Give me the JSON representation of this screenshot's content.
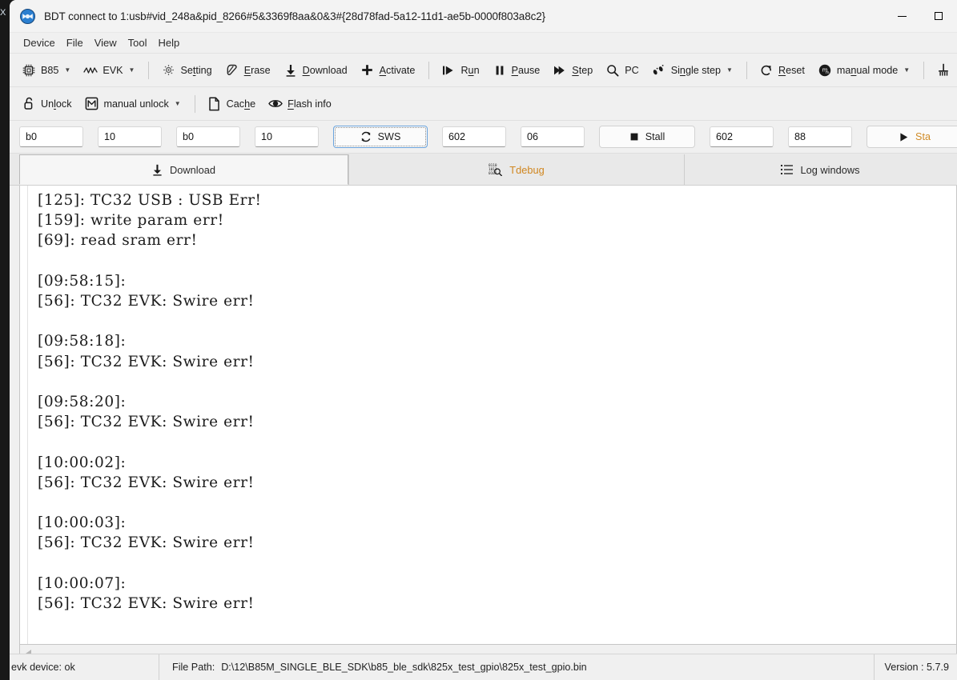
{
  "desktop": {
    "corner_glyph": "X"
  },
  "window": {
    "title": "BDT connect to 1:usb#vid_248a&pid_8266#5&3369f8aa&0&3#{28d78fad-5a12-11d1-ae5b-0000f803a8c2}",
    "app_icon": "bdt-app-icon",
    "controls": {
      "minimize": "minimize",
      "maximize": "maximize"
    }
  },
  "menubar": {
    "items": [
      {
        "label": "Device"
      },
      {
        "label": "File"
      },
      {
        "label": "View"
      },
      {
        "label": "Tool"
      },
      {
        "label": "Help"
      }
    ]
  },
  "toolbar_main": {
    "items": [
      {
        "label": "B85",
        "icon": "chip-icon",
        "caret": true
      },
      {
        "label": "EVK",
        "icon": "waveform-icon",
        "caret": true
      },
      {
        "sep": true
      },
      {
        "label": "Setting",
        "icon": "gear-icon",
        "accel": "t"
      },
      {
        "label": "Erase",
        "icon": "eraser-icon",
        "accel": "E"
      },
      {
        "label": "Download",
        "icon": "download-arrow-icon",
        "accel": "D"
      },
      {
        "label": "Activate",
        "icon": "plus-icon",
        "accel": "A"
      },
      {
        "sep": true
      },
      {
        "label": "Run",
        "icon": "run-icon",
        "accel": "u"
      },
      {
        "label": "Pause",
        "icon": "pause-icon",
        "accel": "P"
      },
      {
        "label": "Step",
        "icon": "step-icon",
        "accel": "S"
      },
      {
        "label": "PC",
        "icon": "magnifier-icon"
      },
      {
        "label": "Single step",
        "icon": "footsteps-icon",
        "accel": "n",
        "caret": true
      },
      {
        "sep": true
      },
      {
        "label": "Reset",
        "icon": "reset-icon",
        "accel": "R"
      },
      {
        "label": "manual mode",
        "icon": "manual-mode-icon",
        "accel": "n",
        "caret": true
      },
      {
        "sep": true
      },
      {
        "label": "",
        "icon": "pin-icon"
      }
    ]
  },
  "toolbar_second": {
    "items": [
      {
        "label": "Unlock",
        "icon": "padlock-open-icon",
        "accel": "l"
      },
      {
        "label": "manual unlock",
        "icon": "m-box-icon",
        "caret": true
      },
      {
        "sep": true
      },
      {
        "label": "Cache",
        "icon": "page-icon",
        "accel": "h"
      },
      {
        "label": "Flash info",
        "icon": "eye-icon",
        "accel": "F"
      }
    ]
  },
  "fieldrow": {
    "fields": [
      {
        "name": "addr1",
        "value": "b0"
      },
      {
        "name": "len1",
        "value": "10"
      },
      {
        "name": "addr2",
        "value": "b0"
      },
      {
        "name": "len2",
        "value": "10"
      }
    ],
    "sws_button": {
      "label": "SWS",
      "icon": "refresh-icon"
    },
    "fields2": [
      {
        "name": "sws-val1",
        "value": "602"
      },
      {
        "name": "sws-val2",
        "value": "06"
      }
    ],
    "stall_button": {
      "label": "Stall",
      "icon": "square-stop-icon"
    },
    "fields3": [
      {
        "name": "stall-val1",
        "value": "602"
      },
      {
        "name": "stall-val2",
        "value": "88"
      }
    ],
    "start_button": {
      "label": "Sta",
      "icon": "play-icon"
    }
  },
  "tabs": [
    {
      "label": "Download",
      "icon": "download-arrow-icon",
      "active": true
    },
    {
      "label": "Tdebug",
      "icon": "binary-search-icon",
      "active": false
    },
    {
      "label": "Log windows",
      "icon": "list-icon",
      "active": false
    }
  ],
  "log": {
    "text": "[125]: TC32 USB : USB Err!\n[159]: write param err!\n[69]: read sram err!\n\n[09:58:15]:\n[56]: TC32 EVK: Swire err!\n\n[09:58:18]:\n[56]: TC32 EVK: Swire err!\n\n[09:58:20]:\n[56]: TC32 EVK: Swire err!\n\n[10:00:02]:\n[56]: TC32 EVK: Swire err!\n\n[10:00:03]:\n[56]: TC32 EVK: Swire err!\n\n[10:00:07]:\n[56]: TC32 EVK: Swire err!",
    "lines": [
      "[125]: TC32 USB : USB Err!",
      "[159]: write param err!",
      "[69]: read sram err!",
      "",
      "[09:58:15]:",
      "[56]: TC32 EVK: Swire err!",
      "",
      "[09:58:18]:",
      "[56]: TC32 EVK: Swire err!",
      "",
      "[09:58:20]:",
      "[56]: TC32 EVK: Swire err!",
      "",
      "[10:00:02]:",
      "[56]: TC32 EVK: Swire err!",
      "",
      "[10:00:03]:",
      "[56]: TC32 EVK: Swire err!",
      "",
      "[10:00:07]:",
      "[56]: TC32 EVK: Swire err!"
    ]
  },
  "statusbar": {
    "device_status": "evk device: ok",
    "file_path_label": "File Path:",
    "file_path_value": "D:\\12\\B85M_SINGLE_BLE_SDK\\b85_ble_sdk\\825x_test_gpio\\825x_test_gpio.bin",
    "version": "Version : 5.7.9"
  },
  "colors": {
    "accent_orange": "#d0861f",
    "window_bg": "#f0f0f0",
    "log_bg": "#ffffff",
    "tab_active_bg": "#f6f6f6"
  }
}
